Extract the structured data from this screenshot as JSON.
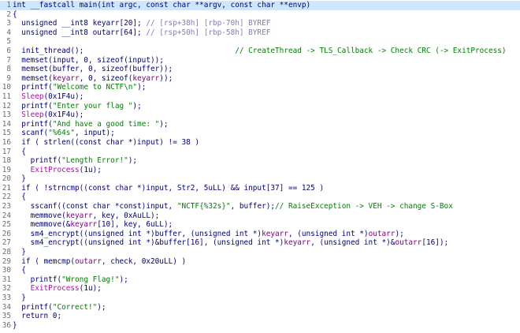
{
  "code_lines": [
    {
      "n": "1",
      "hl": true,
      "t": [
        [
          "k",
          "int __fastcall main(int argc, const char **argv, const char **envp)"
        ]
      ]
    },
    {
      "n": "2",
      "t": [
        [
          "k",
          "{"
        ]
      ]
    },
    {
      "n": "3",
      "t": [
        [
          "k",
          "  unsigned __int8 keyarr[20]; "
        ],
        [
          "d",
          "// [rsp+38h] [rbp-70h] BYREF"
        ]
      ]
    },
    {
      "n": "4",
      "t": [
        [
          "k",
          "  unsigned __int8 outarr[64]; "
        ],
        [
          "d",
          "// [rsp+50h] [rbp-58h] BYREF"
        ]
      ]
    },
    {
      "n": "5",
      "t": [
        [
          "k",
          ""
        ]
      ]
    },
    {
      "n": "6",
      "t": [
        [
          "k",
          "  init_thread();                                  "
        ],
        [
          "s",
          "// CreateThread -> TLS_Callback -> Check CRC (-> ExitProcess)"
        ]
      ]
    },
    {
      "n": "7",
      "t": [
        [
          "k",
          "  memset(input, 0, sizeof(input));"
        ]
      ]
    },
    {
      "n": "8",
      "t": [
        [
          "k",
          "  memset(buffer, 0, sizeof(buffer));"
        ]
      ]
    },
    {
      "n": "9",
      "t": [
        [
          "k",
          "  memset("
        ],
        [
          "v",
          "keyarr"
        ],
        [
          "k",
          ", 0, sizeof("
        ],
        [
          "v",
          "keyarr"
        ],
        [
          "k",
          "));"
        ]
      ]
    },
    {
      "n": "10",
      "t": [
        [
          "k",
          "  printf("
        ],
        [
          "s",
          "\"Welcome to NCTF\\n\""
        ],
        [
          "k",
          ");"
        ]
      ]
    },
    {
      "n": "11",
      "t": [
        [
          "m",
          "  Sleep"
        ],
        [
          "k",
          "(0x1F4u);"
        ]
      ]
    },
    {
      "n": "12",
      "t": [
        [
          "k",
          "  printf("
        ],
        [
          "s",
          "\"Enter your flag \""
        ],
        [
          "k",
          ");"
        ]
      ]
    },
    {
      "n": "13",
      "t": [
        [
          "m",
          "  Sleep"
        ],
        [
          "k",
          "(0x1F4u);"
        ]
      ]
    },
    {
      "n": "14",
      "t": [
        [
          "k",
          "  printf("
        ],
        [
          "s",
          "\"And have a good time: \""
        ],
        [
          "k",
          ");"
        ]
      ]
    },
    {
      "n": "15",
      "t": [
        [
          "k",
          "  scanf("
        ],
        [
          "s",
          "\"%64s\""
        ],
        [
          "k",
          ", input);"
        ]
      ]
    },
    {
      "n": "16",
      "t": [
        [
          "k",
          "  if ( strlen((const char *)input) != 38 )"
        ]
      ]
    },
    {
      "n": "17",
      "t": [
        [
          "k",
          "  {"
        ]
      ]
    },
    {
      "n": "18",
      "t": [
        [
          "k",
          "    printf("
        ],
        [
          "s",
          "\"Length Error!\""
        ],
        [
          "k",
          ");"
        ]
      ]
    },
    {
      "n": "19",
      "t": [
        [
          "m",
          "    ExitProcess"
        ],
        [
          "k",
          "(1u);"
        ]
      ]
    },
    {
      "n": "20",
      "t": [
        [
          "k",
          "  }"
        ]
      ]
    },
    {
      "n": "21",
      "t": [
        [
          "k",
          "  if ( !strncmp((const char *)input, Str2, 5uLL) && input[37] == 125 )"
        ]
      ]
    },
    {
      "n": "22",
      "t": [
        [
          "k",
          "  {"
        ]
      ]
    },
    {
      "n": "23",
      "t": [
        [
          "k",
          "    sscanf((const char *const)input, "
        ],
        [
          "s",
          "\"NCTF{%32s}\""
        ],
        [
          "k",
          ", buffer);"
        ],
        [
          "s",
          "// RaiseException -> VEH -> change S-Box"
        ]
      ]
    },
    {
      "n": "24",
      "t": [
        [
          "k",
          "    memmove("
        ],
        [
          "v",
          "keyarr"
        ],
        [
          "k",
          ", key, 0xAuLL);"
        ]
      ]
    },
    {
      "n": "25",
      "t": [
        [
          "k",
          "    memmove(&"
        ],
        [
          "v",
          "keyarr"
        ],
        [
          "k",
          "[10], key, 6uLL);"
        ]
      ]
    },
    {
      "n": "26",
      "t": [
        [
          "k",
          "    sm4_encrypt((unsigned int *)buffer, (unsigned int *)"
        ],
        [
          "v",
          "keyarr"
        ],
        [
          "k",
          ", (unsigned int *)"
        ],
        [
          "v",
          "outarr"
        ],
        [
          "k",
          ");"
        ]
      ]
    },
    {
      "n": "27",
      "t": [
        [
          "k",
          "    sm4_encrypt((unsigned int *)&buffer[16], (unsigned int *)"
        ],
        [
          "v",
          "keyarr"
        ],
        [
          "k",
          ", (unsigned int *)&"
        ],
        [
          "v",
          "outarr"
        ],
        [
          "k",
          "[16]);"
        ]
      ]
    },
    {
      "n": "28",
      "t": [
        [
          "k",
          "  }"
        ]
      ]
    },
    {
      "n": "29",
      "t": [
        [
          "k",
          "  if ( memcmp("
        ],
        [
          "v",
          "outarr"
        ],
        [
          "k",
          ", check, 0x20uLL) )"
        ]
      ]
    },
    {
      "n": "30",
      "t": [
        [
          "k",
          "  {"
        ]
      ]
    },
    {
      "n": "31",
      "t": [
        [
          "k",
          "    printf("
        ],
        [
          "s",
          "\"Wrong Flag!\""
        ],
        [
          "k",
          ");"
        ]
      ]
    },
    {
      "n": "32",
      "t": [
        [
          "m",
          "    ExitProcess"
        ],
        [
          "k",
          "(1u);"
        ]
      ]
    },
    {
      "n": "33",
      "t": [
        [
          "k",
          "  }"
        ]
      ]
    },
    {
      "n": "34",
      "t": [
        [
          "k",
          "  printf("
        ],
        [
          "s",
          "\"Correct!\""
        ],
        [
          "k",
          ");"
        ]
      ]
    },
    {
      "n": "35",
      "t": [
        [
          "k",
          "  return 0;"
        ]
      ]
    },
    {
      "n": "36",
      "t": [
        [
          "k",
          "}"
        ]
      ]
    }
  ],
  "colors": {
    "keyword_text": "#000080",
    "string_and_comment": "#008000",
    "comment_dim": "#7d7dbd",
    "local_variable": "#800080",
    "api_call": "#c000c0",
    "line_number": "#6e6e6e",
    "highlight_line": "#cfe6ff",
    "background": "#ffffff"
  }
}
